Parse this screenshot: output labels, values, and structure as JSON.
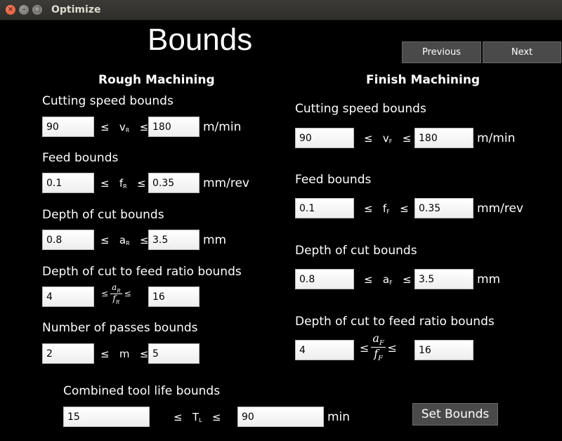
{
  "window": {
    "title": "Optimize"
  },
  "page": {
    "title": "Bounds"
  },
  "nav": {
    "previous_label": "Previous",
    "next_label": "Next"
  },
  "rough": {
    "heading": "Rough Machining",
    "cutting_speed": {
      "label": "Cutting speed bounds",
      "min": "90",
      "max": "180",
      "unit": "m/min"
    },
    "feed": {
      "label": "Feed bounds",
      "min": "0.1",
      "max": "0.35",
      "unit": "mm/rev"
    },
    "depth": {
      "label": "Depth of cut bounds",
      "min": "0.8",
      "max": "3.5",
      "unit": "mm"
    },
    "ratio": {
      "label": "Depth of cut to feed ratio bounds",
      "min": "4",
      "max": "16"
    },
    "passes": {
      "label": "Number of passes bounds",
      "min": "2",
      "max": "5"
    }
  },
  "finish": {
    "heading": "Finish Machining",
    "cutting_speed": {
      "label": "Cutting speed bounds",
      "min": "90",
      "max": "180",
      "unit": "m/min"
    },
    "feed": {
      "label": "Feed bounds",
      "min": "0.1",
      "max": "0.35",
      "unit": "mm/rev"
    },
    "depth": {
      "label": "Depth of cut bounds",
      "min": "0.8",
      "max": "3.5",
      "unit": "mm"
    },
    "ratio": {
      "label": "Depth of cut to feed ratio bounds",
      "min": "4",
      "max": "16"
    }
  },
  "tool_life": {
    "label": "Combined tool life bounds",
    "min": "15",
    "max": "90",
    "unit": "min"
  },
  "symbols": {
    "le": "≤",
    "vR": "v",
    "fR": "f",
    "aR": "a",
    "m": "m",
    "TL": "T",
    "sub_R": "R",
    "sub_F": "F",
    "sub_L": "L"
  },
  "set_bounds_label": "Set Bounds"
}
